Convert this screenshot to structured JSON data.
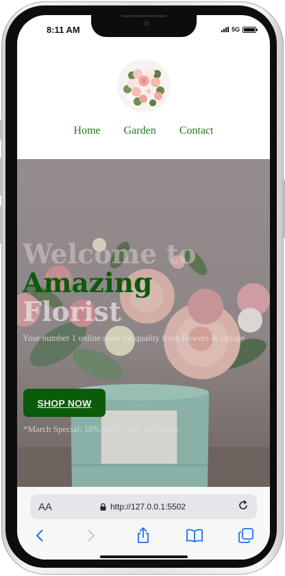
{
  "status_bar": {
    "time": "8:11 AM",
    "network": "5G"
  },
  "nav": {
    "items": [
      "Home",
      "Garden",
      "Contact"
    ]
  },
  "hero": {
    "title_line1": "Welcome to",
    "title_line2": "Amazing",
    "title_line3": "Florist",
    "tagline": "Your number 1 online store for quality fresh flowers & foliage",
    "shop_button": "SHOP NOW",
    "promo": "*March Special: 10% off for any web order."
  },
  "browser": {
    "text_size_label": "AA",
    "url": "http://127.0.0.1:5502"
  },
  "icons": {
    "logo": "flower-bouquet-logo",
    "lock": "lock-icon",
    "reload": "reload-icon",
    "back": "back-icon",
    "forward": "forward-icon",
    "share": "share-icon",
    "bookmarks": "bookmarks-icon",
    "tabs": "tabs-icon"
  },
  "colors": {
    "nav": "#1a7a1a",
    "brand_green": "#0a5c0a",
    "ios_blue": "#1e6fe8"
  }
}
